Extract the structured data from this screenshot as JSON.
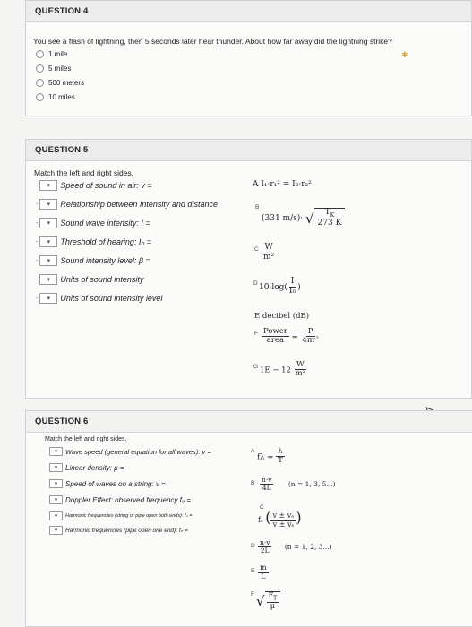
{
  "q4": {
    "header": "QUESTION 4",
    "prompt": "You see a flash of lightning, then 5 seconds later hear thunder. About how far away did the lightning strike?",
    "options": [
      "1 mile",
      "5 miles",
      "500 meters",
      "10 miles"
    ]
  },
  "q5": {
    "header": "QUESTION 5",
    "prompt": "Match the left and right sides.",
    "items": [
      "Speed of sound in air: v =",
      "Relationship between Intensity and distance",
      "Sound wave intensity: I =",
      "Threshold of hearing: I₀ =",
      "Sound intensity level: β =",
      "Units of sound intensity",
      "Units of sound intensity level"
    ],
    "answers": {
      "A": "A I₁·r₁² = I₂·r₂²",
      "B": "(331 m/s)·√(T_K / 273 K)",
      "C": "W/m²",
      "D": "10·log(I/I₀)",
      "E": "E decibel (dB)",
      "F": "Power/area = P/4πr²",
      "G": "1E−12 W/m²"
    },
    "ans_labels": {
      "B": "B",
      "C": "C",
      "D": "D",
      "E": "E decibel (dB)",
      "F": "F",
      "G": "G"
    },
    "ans_text": {
      "b_const": "(331 m/s)·",
      "b_num": "T",
      "b_num_sub": "K",
      "b_den": "273 K",
      "c_num": "W",
      "c_den": "m²",
      "d_prefix": "10·log",
      "d_num": "I",
      "d_den": "I₀",
      "f_num": "Power",
      "f_den": "area",
      "f_eq": "=",
      "f_rnum": "P",
      "f_rden": "4πr²",
      "g_val": "1E − 12",
      "g_num": "W",
      "g_den": "m²"
    }
  },
  "q6": {
    "header": "QUESTION 6",
    "prompt": "Match the left and right sides.",
    "items": [
      "Wave speed (general equation for all waves): v =",
      "Linear density: μ =",
      "Speed of waves on a string: v =",
      "Doppler Effect: observed frequency fₒ =",
      "Harmonic frequencies (string or pipe open both ends): fₙ =",
      "Harmonic frequencies (pipe open one end): fₙ ="
    ],
    "ans_labels": {
      "A": "A",
      "B": "B",
      "C": "C",
      "D": "D",
      "E": "E",
      "F": "F"
    },
    "ans_text": {
      "a_lhs": "fλ =",
      "a_num": "λ",
      "a_den": "T",
      "b_num": "n·v",
      "b_den": "4L",
      "b_n": "(n = 1, 3, 5...)",
      "c_f": "fₛ",
      "c_num": "v ± vₒ",
      "c_den": "v ± vₛ",
      "d_num": "n·v",
      "d_den": "2L",
      "d_n": "(n = 1, 2, 3...)",
      "e_num": "m",
      "e_den": "L",
      "f_num": "F",
      "f_num_sub": "T",
      "f_den": "μ"
    }
  },
  "icons": {
    "star": "star-icon",
    "cursor": "cursor-icon",
    "chevron": "chevron-down-icon"
  }
}
